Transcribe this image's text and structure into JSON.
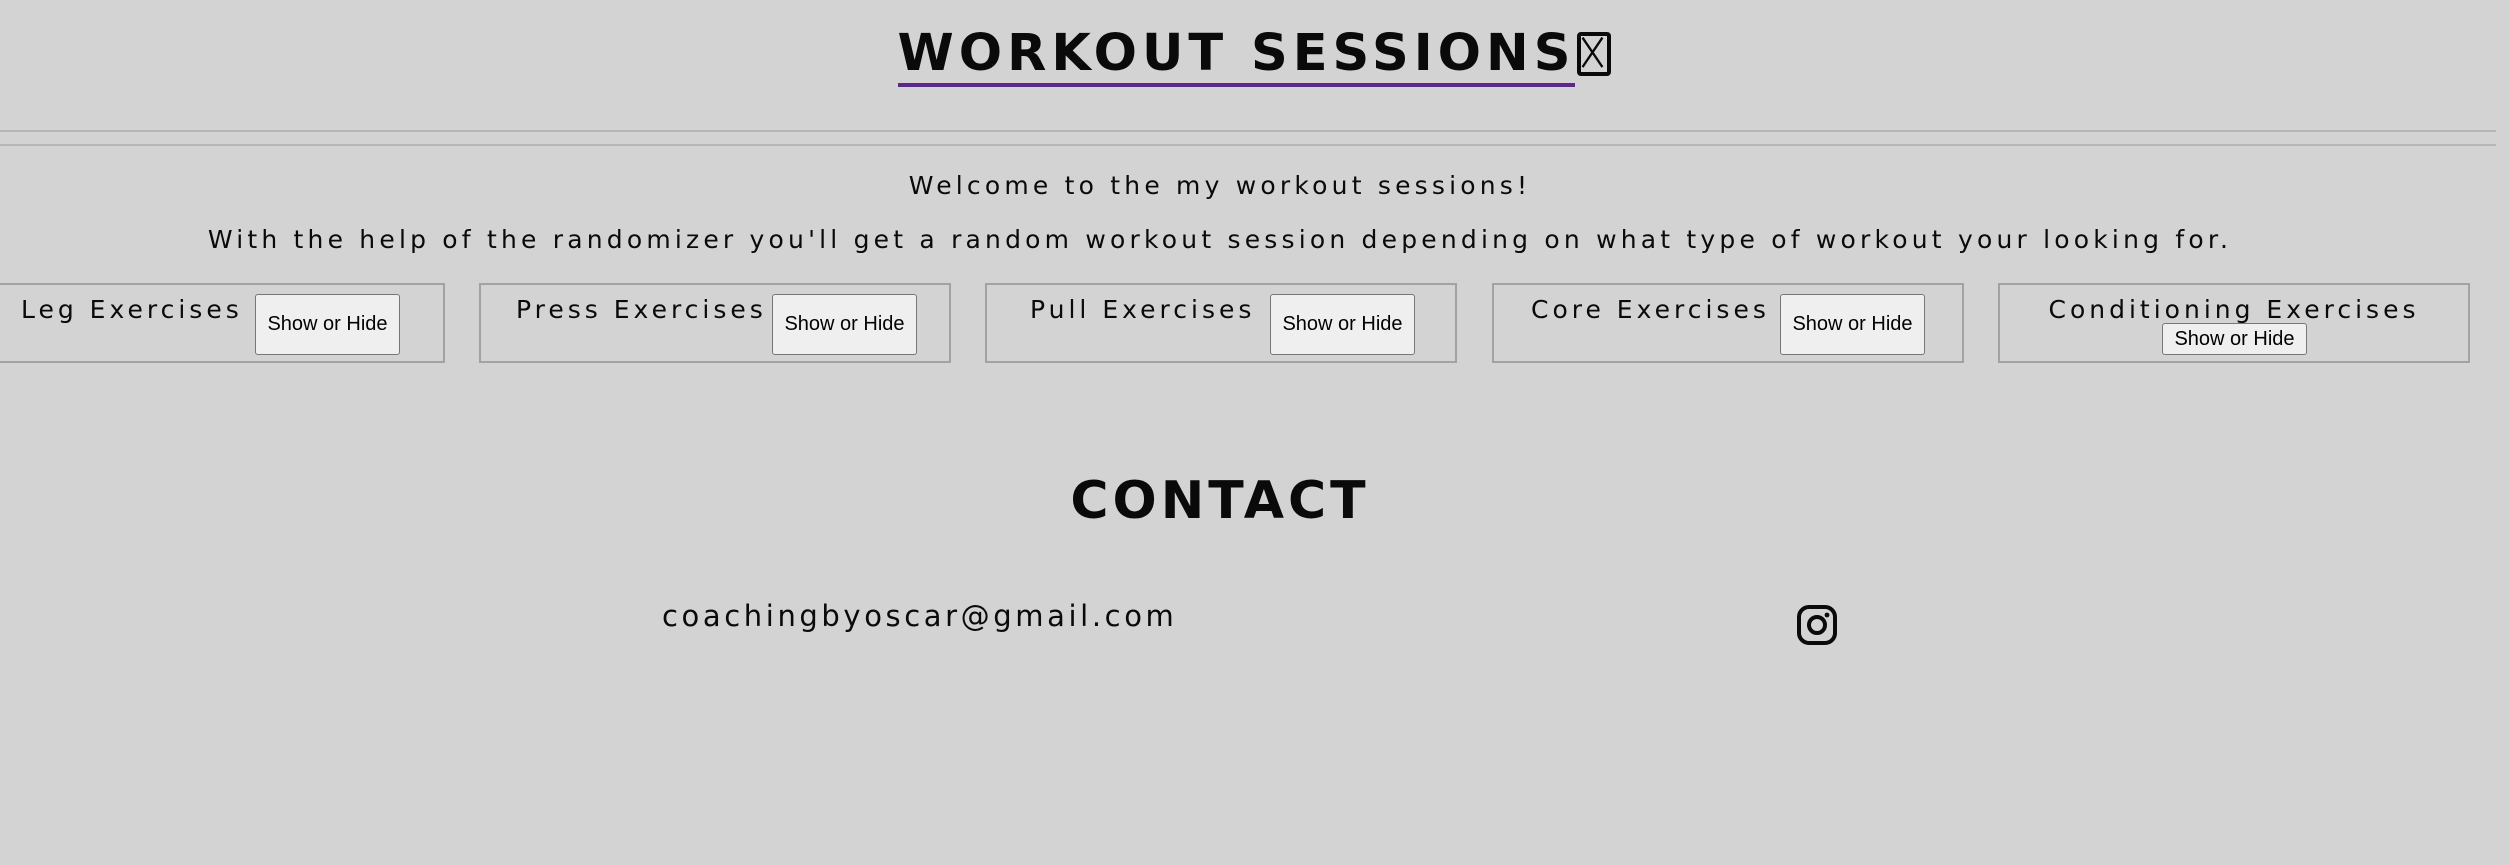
{
  "header": {
    "title": "WORKOUT SESSIONS",
    "title_glyph": "missing-glyph-icon",
    "underline_color": "#5b2a86"
  },
  "intro": {
    "welcome": "Welcome to the my workout sessions!",
    "description": "With the help of the randomizer you'll get a random workout session depending on what type of workout your looking for."
  },
  "sections": [
    {
      "label": "Leg Exercises",
      "button": "Show or Hide"
    },
    {
      "label": "Press Exercises",
      "button": "Show or Hide"
    },
    {
      "label": "Pull Exercises",
      "button": "Show or Hide"
    },
    {
      "label": "Core Exercises",
      "button": "Show or Hide"
    },
    {
      "label": "Conditioning Exercises",
      "button": "Show or Hide"
    }
  ],
  "contact": {
    "title": "CONTACT",
    "email": "coachingbyoscar@gmail.com",
    "social_icon": "instagram-icon"
  },
  "colors": {
    "background": "#d3d3d3",
    "text": "#0a0a0a",
    "button_bg": "#efefef",
    "box_border": "#a2a2a2"
  }
}
